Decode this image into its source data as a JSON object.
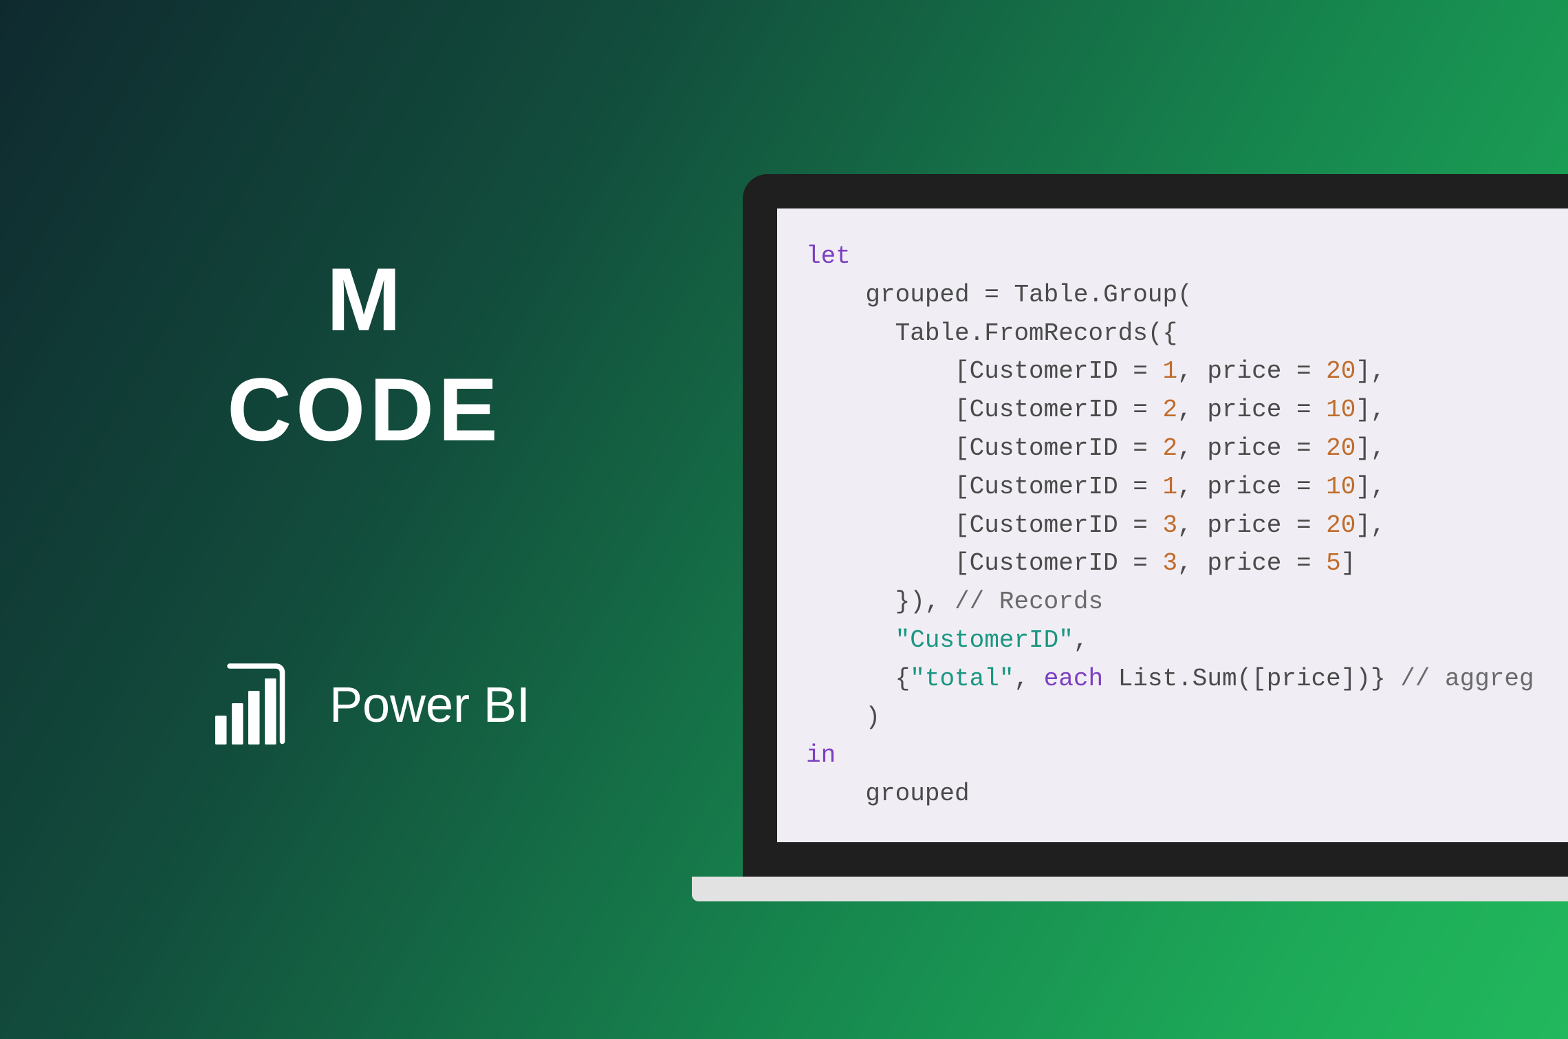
{
  "title": {
    "line1": "M",
    "line2": "CODE"
  },
  "brand": {
    "text": "Power BI",
    "icon_name": "power-bi-icon"
  },
  "code": {
    "colors": {
      "keyword": "#7d3fc0",
      "number": "#c06c2c",
      "string": "#1b9682",
      "identifier": "#4a4a4a",
      "comment": "#6a6a6a"
    },
    "lines": [
      [
        {
          "t": "kw",
          "v": "let"
        }
      ],
      [
        {
          "t": "id",
          "v": "    grouped "
        },
        {
          "t": "op",
          "v": "= "
        },
        {
          "t": "id",
          "v": "Table.Group("
        }
      ],
      [
        {
          "t": "id",
          "v": "      Table.FromRecords({"
        }
      ],
      [
        {
          "t": "id",
          "v": "          [CustomerID "
        },
        {
          "t": "op",
          "v": "= "
        },
        {
          "t": "num",
          "v": "1"
        },
        {
          "t": "id",
          "v": ", price "
        },
        {
          "t": "op",
          "v": "= "
        },
        {
          "t": "num",
          "v": "20"
        },
        {
          "t": "id",
          "v": "],"
        }
      ],
      [
        {
          "t": "id",
          "v": "          [CustomerID "
        },
        {
          "t": "op",
          "v": "= "
        },
        {
          "t": "num",
          "v": "2"
        },
        {
          "t": "id",
          "v": ", price "
        },
        {
          "t": "op",
          "v": "= "
        },
        {
          "t": "num",
          "v": "10"
        },
        {
          "t": "id",
          "v": "],"
        }
      ],
      [
        {
          "t": "id",
          "v": "          [CustomerID "
        },
        {
          "t": "op",
          "v": "= "
        },
        {
          "t": "num",
          "v": "2"
        },
        {
          "t": "id",
          "v": ", price "
        },
        {
          "t": "op",
          "v": "= "
        },
        {
          "t": "num",
          "v": "20"
        },
        {
          "t": "id",
          "v": "],"
        }
      ],
      [
        {
          "t": "id",
          "v": "          [CustomerID "
        },
        {
          "t": "op",
          "v": "= "
        },
        {
          "t": "num",
          "v": "1"
        },
        {
          "t": "id",
          "v": ", price "
        },
        {
          "t": "op",
          "v": "= "
        },
        {
          "t": "num",
          "v": "10"
        },
        {
          "t": "id",
          "v": "],"
        }
      ],
      [
        {
          "t": "id",
          "v": "          [CustomerID "
        },
        {
          "t": "op",
          "v": "= "
        },
        {
          "t": "num",
          "v": "3"
        },
        {
          "t": "id",
          "v": ", price "
        },
        {
          "t": "op",
          "v": "= "
        },
        {
          "t": "num",
          "v": "20"
        },
        {
          "t": "id",
          "v": "],"
        }
      ],
      [
        {
          "t": "id",
          "v": "          [CustomerID "
        },
        {
          "t": "op",
          "v": "= "
        },
        {
          "t": "num",
          "v": "3"
        },
        {
          "t": "id",
          "v": ", price "
        },
        {
          "t": "op",
          "v": "= "
        },
        {
          "t": "num",
          "v": "5"
        },
        {
          "t": "id",
          "v": "]"
        }
      ],
      [
        {
          "t": "id",
          "v": "      }), "
        },
        {
          "t": "com",
          "v": "// Records"
        }
      ],
      [
        {
          "t": "id",
          "v": "      "
        },
        {
          "t": "str",
          "v": "\"CustomerID\""
        },
        {
          "t": "id",
          "v": ","
        }
      ],
      [
        {
          "t": "id",
          "v": "      {"
        },
        {
          "t": "str",
          "v": "\"total\""
        },
        {
          "t": "id",
          "v": ", "
        },
        {
          "t": "kw",
          "v": "each"
        },
        {
          "t": "id",
          "v": " List.Sum([price])} "
        },
        {
          "t": "com",
          "v": "// aggreg"
        }
      ],
      [
        {
          "t": "id",
          "v": "    )"
        }
      ],
      [
        {
          "t": "kw",
          "v": "in"
        }
      ],
      [
        {
          "t": "id",
          "v": "    grouped"
        }
      ]
    ]
  }
}
